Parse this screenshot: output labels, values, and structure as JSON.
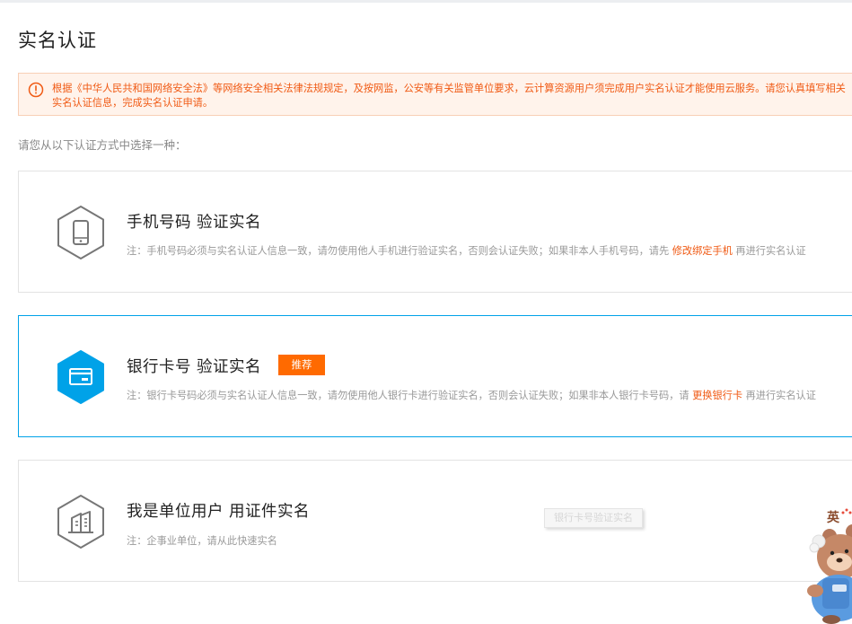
{
  "page": {
    "title": "实名认证",
    "notice": "根据《中华人民共和国网络安全法》等网络安全相关法律法规规定，及按网监，公安等有关监管单位要求，云计算资源用户须完成用户实名认证才能使用云服务。请您认真填写相关实名认证信息，完成实名认证申请。",
    "prompt": "请您从以下认证方式中选择一种："
  },
  "methods": [
    {
      "title": "手机号码 验证实名",
      "note_before": "注：手机号码必须与实名认证人信息一致，请勿使用他人手机进行验证实名，否则会认证失败；如果非本人手机号码，请先 ",
      "link": "修改绑定手机",
      "note_after": " 再进行实名认证",
      "icon": "mobile-phone-icon"
    },
    {
      "title": "银行卡号 验证实名",
      "badge": "推荐",
      "note_before": "注：银行卡号码必须与实名认证人信息一致，请勿使用他人银行卡进行验证实名，否则会认证失败；如果非本人银行卡号码，请 ",
      "link": "更换银行卡",
      "note_after": " 再进行实名认证",
      "icon": "bank-card-icon"
    },
    {
      "title": "我是单位用户 用证件实名",
      "note": "注：企事业单位，请从此快速实名",
      "icon": "building-icon"
    }
  ],
  "tooltip": "银行卡号验证实名",
  "mascot": {
    "label": "英"
  },
  "colors": {
    "accent_orange": "#ff6a00",
    "link_orange": "#f05a14",
    "selected_blue": "#00a2e8",
    "icon_gray": "#777777",
    "notice_bg": "#fff3eb"
  }
}
